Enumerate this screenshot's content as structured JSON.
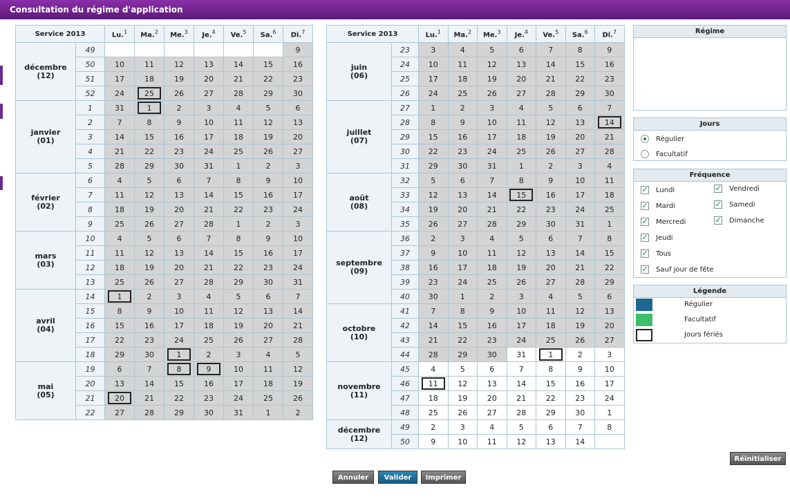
{
  "window": {
    "title": "Consultation du régime d'application"
  },
  "colors": {
    "regulier": "#1e6890",
    "facultatif": "#3cbf6a",
    "ferie_border": "#222222",
    "service_day": "#d4d4d4"
  },
  "calendar": {
    "header": {
      "service": "Service 2013",
      "days": [
        {
          "label": "Lu.",
          "num": "1"
        },
        {
          "label": "Ma.",
          "num": "2"
        },
        {
          "label": "Me.",
          "num": "3"
        },
        {
          "label": "Je.",
          "num": "4"
        },
        {
          "label": "Ve.",
          "num": "5"
        },
        {
          "label": "Sa.",
          "num": "6"
        },
        {
          "label": "Di.",
          "num": "7"
        }
      ]
    },
    "left": [
      {
        "name": "décembre",
        "num": "(12)",
        "weeks": [
          {
            "w": "49",
            "days": [
              "e",
              "e",
              "e",
              "e",
              "e",
              "e",
              "d:9"
            ]
          },
          {
            "w": "50",
            "days": [
              "d:10",
              "d:11",
              "d:12",
              "d:13",
              "d:14",
              "d:15",
              "d:16"
            ]
          },
          {
            "w": "51",
            "days": [
              "d:17",
              "d:18",
              "d:19",
              "d:20",
              "d:21",
              "d:22",
              "d:23"
            ]
          },
          {
            "w": "52",
            "days": [
              "d:24",
              "h:25",
              "d:26",
              "d:27",
              "d:28",
              "d:29",
              "d:30"
            ]
          }
        ]
      },
      {
        "name": "janvier",
        "num": "(01)",
        "weeks": [
          {
            "w": "1",
            "days": [
              "d:31",
              "h:1",
              "d:2",
              "d:3",
              "d:4",
              "d:5",
              "d:6"
            ]
          },
          {
            "w": "2",
            "days": [
              "d:7",
              "d:8",
              "d:9",
              "d:10",
              "d:11",
              "d:12",
              "d:13"
            ]
          },
          {
            "w": "3",
            "days": [
              "d:14",
              "d:15",
              "d:16",
              "d:17",
              "d:18",
              "d:19",
              "d:20"
            ]
          },
          {
            "w": "4",
            "days": [
              "d:21",
              "d:22",
              "d:23",
              "d:24",
              "d:25",
              "d:26",
              "d:27"
            ]
          },
          {
            "w": "5",
            "days": [
              "d:28",
              "d:29",
              "d:30",
              "d:31",
              "d:1",
              "d:2",
              "d:3"
            ]
          }
        ]
      },
      {
        "name": "février",
        "num": "(02)",
        "weeks": [
          {
            "w": "6",
            "days": [
              "d:4",
              "d:5",
              "d:6",
              "d:7",
              "d:8",
              "d:9",
              "d:10"
            ]
          },
          {
            "w": "7",
            "days": [
              "d:11",
              "d:12",
              "d:13",
              "d:14",
              "d:15",
              "d:16",
              "d:17"
            ]
          },
          {
            "w": "8",
            "days": [
              "d:18",
              "d:19",
              "d:20",
              "d:21",
              "d:22",
              "d:23",
              "d:24"
            ]
          },
          {
            "w": "9",
            "days": [
              "d:25",
              "d:26",
              "d:27",
              "d:28",
              "d:1",
              "d:2",
              "d:3"
            ]
          }
        ]
      },
      {
        "name": "mars",
        "num": "(03)",
        "weeks": [
          {
            "w": "10",
            "days": [
              "d:4",
              "d:5",
              "d:6",
              "d:7",
              "d:8",
              "d:9",
              "d:10"
            ]
          },
          {
            "w": "11",
            "days": [
              "d:11",
              "d:12",
              "d:13",
              "d:14",
              "d:15",
              "d:16",
              "d:17"
            ]
          },
          {
            "w": "12",
            "days": [
              "d:18",
              "d:19",
              "d:20",
              "d:21",
              "d:22",
              "d:23",
              "d:24"
            ]
          },
          {
            "w": "13",
            "days": [
              "d:25",
              "d:26",
              "d:27",
              "d:28",
              "d:29",
              "d:30",
              "d:31"
            ]
          }
        ]
      },
      {
        "name": "avril",
        "num": "(04)",
        "weeks": [
          {
            "w": "14",
            "days": [
              "h:1",
              "d:2",
              "d:3",
              "d:4",
              "d:5",
              "d:6",
              "d:7"
            ]
          },
          {
            "w": "15",
            "days": [
              "d:8",
              "d:9",
              "d:10",
              "d:11",
              "d:12",
              "d:13",
              "d:14"
            ]
          },
          {
            "w": "16",
            "days": [
              "d:15",
              "d:16",
              "d:17",
              "d:18",
              "d:19",
              "d:20",
              "d:21"
            ]
          },
          {
            "w": "17",
            "days": [
              "d:22",
              "d:23",
              "d:24",
              "d:25",
              "d:26",
              "d:27",
              "d:28"
            ]
          },
          {
            "w": "18",
            "days": [
              "d:29",
              "d:30",
              "h:1",
              "d:2",
              "d:3",
              "d:4",
              "d:5"
            ]
          }
        ]
      },
      {
        "name": "mai",
        "num": "(05)",
        "weeks": [
          {
            "w": "19",
            "days": [
              "d:6",
              "d:7",
              "h:8",
              "h:9",
              "d:10",
              "d:11",
              "d:12"
            ]
          },
          {
            "w": "20",
            "days": [
              "d:13",
              "d:14",
              "d:15",
              "d:16",
              "d:17",
              "d:18",
              "d:19"
            ]
          },
          {
            "w": "21",
            "days": [
              "h:20",
              "d:21",
              "d:22",
              "d:23",
              "d:24",
              "d:25",
              "d:26"
            ]
          },
          {
            "w": "22",
            "days": [
              "d:27",
              "d:28",
              "d:29",
              "d:30",
              "d:31",
              "d:1",
              "d:2"
            ]
          }
        ]
      }
    ],
    "right": [
      {
        "name": "juin",
        "num": "(06)",
        "weeks": [
          {
            "w": "23",
            "days": [
              "d:3",
              "d:4",
              "d:5",
              "d:6",
              "d:7",
              "d:8",
              "d:9"
            ]
          },
          {
            "w": "24",
            "days": [
              "d:10",
              "d:11",
              "d:12",
              "d:13",
              "d:14",
              "d:15",
              "d:16"
            ]
          },
          {
            "w": "25",
            "days": [
              "d:17",
              "d:18",
              "d:19",
              "d:20",
              "d:21",
              "d:22",
              "d:23"
            ]
          },
          {
            "w": "26",
            "days": [
              "d:24",
              "d:25",
              "d:26",
              "d:27",
              "d:28",
              "d:29",
              "d:30"
            ]
          }
        ]
      },
      {
        "name": "juillet",
        "num": "(07)",
        "weeks": [
          {
            "w": "27",
            "days": [
              "d:1",
              "d:2",
              "d:3",
              "d:4",
              "d:5",
              "d:6",
              "d:7"
            ]
          },
          {
            "w": "28",
            "days": [
              "d:8",
              "d:9",
              "d:10",
              "d:11",
              "d:12",
              "d:13",
              "h:14"
            ]
          },
          {
            "w": "29",
            "days": [
              "d:15",
              "d:16",
              "d:17",
              "d:18",
              "d:19",
              "d:20",
              "d:21"
            ]
          },
          {
            "w": "30",
            "days": [
              "d:22",
              "d:23",
              "d:24",
              "d:25",
              "d:26",
              "d:27",
              "d:28"
            ]
          },
          {
            "w": "31",
            "days": [
              "d:29",
              "d:30",
              "d:31",
              "d:1",
              "d:2",
              "d:3",
              "d:4"
            ]
          }
        ]
      },
      {
        "name": "août",
        "num": "(08)",
        "weeks": [
          {
            "w": "32",
            "days": [
              "d:5",
              "d:6",
              "d:7",
              "d:8",
              "d:9",
              "d:10",
              "d:11"
            ]
          },
          {
            "w": "33",
            "days": [
              "d:12",
              "d:13",
              "d:14",
              "h:15",
              "d:16",
              "d:17",
              "d:18"
            ]
          },
          {
            "w": "34",
            "days": [
              "d:19",
              "d:20",
              "d:21",
              "d:22",
              "d:23",
              "d:24",
              "d:25"
            ]
          },
          {
            "w": "35",
            "days": [
              "d:26",
              "d:27",
              "d:28",
              "d:29",
              "d:30",
              "d:31",
              "d:1"
            ]
          }
        ]
      },
      {
        "name": "septembre",
        "num": "(09)",
        "weeks": [
          {
            "w": "36",
            "days": [
              "d:2",
              "d:3",
              "d:4",
              "d:5",
              "d:6",
              "d:7",
              "d:8"
            ]
          },
          {
            "w": "37",
            "days": [
              "d:9",
              "d:10",
              "d:11",
              "d:12",
              "d:13",
              "d:14",
              "d:15"
            ]
          },
          {
            "w": "38",
            "days": [
              "d:16",
              "d:17",
              "d:18",
              "d:19",
              "d:20",
              "d:21",
              "d:22"
            ]
          },
          {
            "w": "39",
            "days": [
              "d:23",
              "d:24",
              "d:25",
              "d:26",
              "d:27",
              "d:28",
              "d:29"
            ]
          },
          {
            "w": "40",
            "days": [
              "d:30",
              "d:1",
              "d:2",
              "d:3",
              "d:4",
              "d:5",
              "d:6"
            ]
          }
        ]
      },
      {
        "name": "octobre",
        "num": "(10)",
        "weeks": [
          {
            "w": "41",
            "days": [
              "d:7",
              "d:8",
              "d:9",
              "d:10",
              "d:11",
              "d:12",
              "d:13"
            ]
          },
          {
            "w": "42",
            "days": [
              "d:14",
              "d:15",
              "d:16",
              "d:17",
              "d:18",
              "d:19",
              "d:20"
            ]
          },
          {
            "w": "43",
            "days": [
              "d:21",
              "d:22",
              "d:23",
              "d:24",
              "d:25",
              "d:26",
              "d:27"
            ]
          },
          {
            "w": "44",
            "days": [
              "d:28",
              "d:29",
              "d:30",
              "w:31",
              "h:1",
              "w:2",
              "w:3"
            ]
          }
        ]
      },
      {
        "name": "novembre",
        "num": "(11)",
        "weeks": [
          {
            "w": "45",
            "days": [
              "w:4",
              "w:5",
              "w:6",
              "w:7",
              "w:8",
              "w:9",
              "w:10"
            ]
          },
          {
            "w": "46",
            "days": [
              "h:11",
              "w:12",
              "w:13",
              "w:14",
              "w:15",
              "w:16",
              "w:17"
            ]
          },
          {
            "w": "47",
            "days": [
              "w:18",
              "w:19",
              "w:20",
              "w:21",
              "w:22",
              "w:23",
              "w:24"
            ]
          },
          {
            "w": "48",
            "days": [
              "w:25",
              "w:26",
              "w:27",
              "w:28",
              "w:29",
              "w:30",
              "w:1"
            ]
          }
        ]
      },
      {
        "name": "décembre",
        "num": "(12)",
        "weeks": [
          {
            "w": "49",
            "days": [
              "w:2",
              "w:3",
              "w:4",
              "w:5",
              "w:6",
              "w:7",
              "w:8"
            ]
          },
          {
            "w": "50",
            "days": [
              "w:9",
              "w:10",
              "w:11",
              "w:12",
              "w:13",
              "w:14",
              "e"
            ]
          }
        ]
      }
    ]
  },
  "regime": {
    "title": "Régime"
  },
  "jours": {
    "title": "Jours",
    "options": [
      {
        "label": "Régulier",
        "selected": true
      },
      {
        "label": "Facultatif",
        "selected": false
      }
    ]
  },
  "frequence": {
    "title": "Fréquence",
    "left": [
      {
        "label": "Lundi",
        "checked": true
      },
      {
        "label": "Mardi",
        "checked": true
      },
      {
        "label": "Mercredi",
        "checked": true
      },
      {
        "label": "Jeudi",
        "checked": true
      },
      {
        "label": "Tous",
        "checked": true
      },
      {
        "label": "Sauf jour de fête",
        "checked": true
      }
    ],
    "right": [
      {
        "label": "Vendredi",
        "checked": true
      },
      {
        "label": "Samedi",
        "checked": true
      },
      {
        "label": "Dimanche",
        "checked": true
      }
    ]
  },
  "legende": {
    "title": "Légende",
    "items": [
      "Régulier",
      "Facultatif",
      "Jours fériés"
    ]
  },
  "buttons": {
    "reinitialiser": "Réinitialiser",
    "annuler": "Annuler",
    "valider": "Valider",
    "imprimer": "Imprimer"
  }
}
